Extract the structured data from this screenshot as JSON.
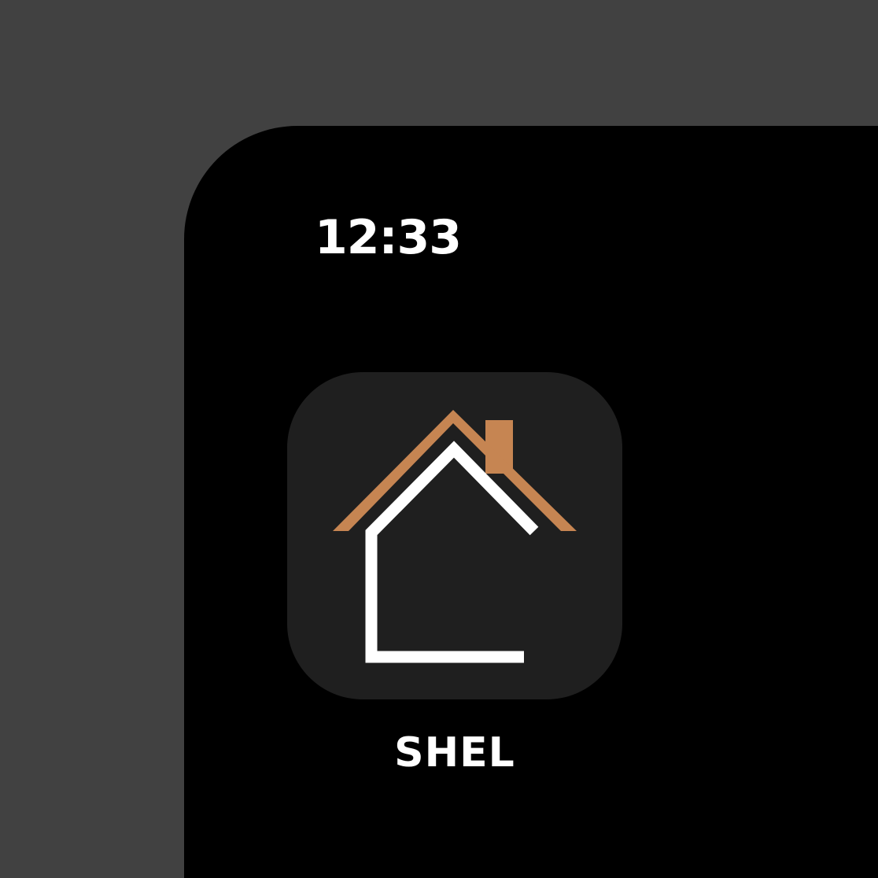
{
  "status_bar": {
    "time": "12:33"
  },
  "app": {
    "label": "SHEL",
    "icon": "house-icon",
    "colors": {
      "roof": "#c68552",
      "house_outline": "#ffffff",
      "tile_background": "#1f1f1f"
    }
  },
  "theme": {
    "backdrop": "#414141",
    "screen": "#000000",
    "text": "#ffffff"
  }
}
